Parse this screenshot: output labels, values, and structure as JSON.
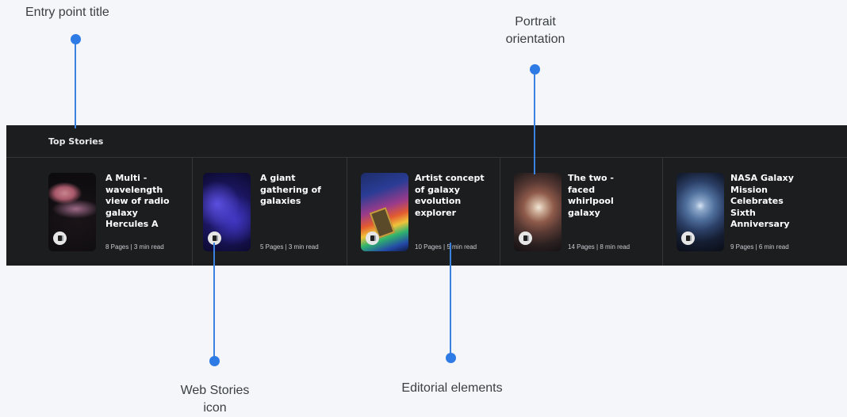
{
  "callouts": {
    "entry_point_title": "Entry point title",
    "portrait_orientation_line1": "Portrait",
    "portrait_orientation_line2": "orientation",
    "web_stories_icon_line1": "Web Stories",
    "web_stories_icon_line2": "icon",
    "editorial_elements": "Editorial elements"
  },
  "colors": {
    "accent": "#2f7be5",
    "strip_bg": "#1c1d1f",
    "page_bg": "#f4f6f9"
  },
  "carousel": {
    "title": "Top Stories",
    "cards": [
      {
        "title": "A Multi - wavelength view of radio galaxy Hercules A",
        "meta": "8 Pages  |  3 min read",
        "icon": "web-stories-icon"
      },
      {
        "title": "A giant gathering of galaxies",
        "meta": "5 Pages | 3 min read",
        "icon": "web-stories-icon"
      },
      {
        "title": "Artist concept of galaxy evolution explorer",
        "meta": "10 Pages | 5 min read",
        "icon": "web-stories-icon"
      },
      {
        "title": "The two - faced whirlpool galaxy",
        "meta": "14 Pages | 8 min read",
        "icon": "web-stories-icon"
      },
      {
        "title": "NASA Galaxy Mission Celebrates Sixth Anniversary",
        "meta": "9 Pages | 6 min read",
        "icon": "web-stories-icon"
      }
    ]
  }
}
